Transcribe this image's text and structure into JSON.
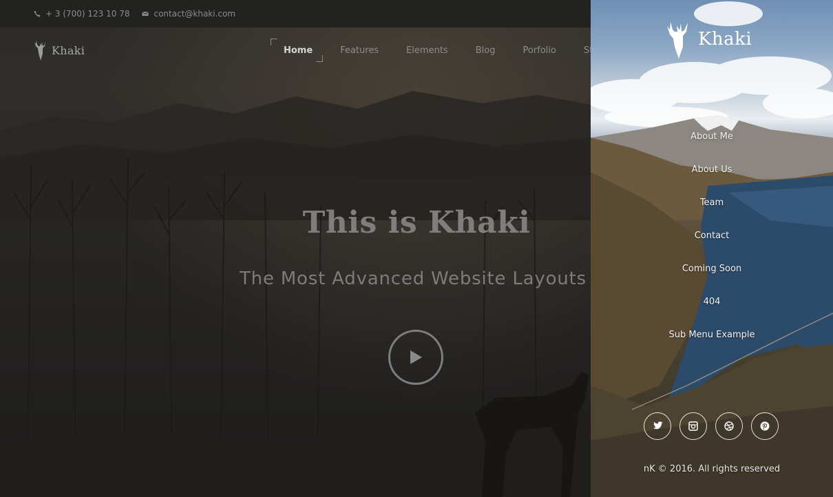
{
  "topbar": {
    "phone": "+ 3 (700) 123 10 78",
    "email": "contact@khaki.com",
    "phone_icon": "phone-icon",
    "email_icon": "mail-icon"
  },
  "header": {
    "logo_text": "Khaki",
    "nav": [
      {
        "label": "Home",
        "active": true
      },
      {
        "label": "Features"
      },
      {
        "label": "Elements"
      },
      {
        "label": "Blog"
      },
      {
        "label": "Porfolio"
      },
      {
        "label": "Sto"
      }
    ]
  },
  "hero": {
    "title": "This is Khaki",
    "subtitle": "The Most Advanced Website Layouts",
    "play_icon": "play-icon"
  },
  "side_panel": {
    "logo_text": "Khaki",
    "menu": [
      {
        "label": "About Me"
      },
      {
        "label": "About Us"
      },
      {
        "label": "Team"
      },
      {
        "label": "Contact"
      },
      {
        "label": "Coming Soon"
      },
      {
        "label": "404"
      },
      {
        "label": "Sub Menu Example"
      }
    ],
    "socials": [
      {
        "icon": "twitter-icon"
      },
      {
        "icon": "instagram-icon"
      },
      {
        "icon": "dribbble-icon"
      },
      {
        "icon": "pinterest-icon"
      }
    ],
    "copyright": "nK © 2016. All rights reserved"
  },
  "colors": {
    "panel_text": "#ffffff",
    "hero_text": "#7f7e7c",
    "topbar_bg": "#222221"
  }
}
